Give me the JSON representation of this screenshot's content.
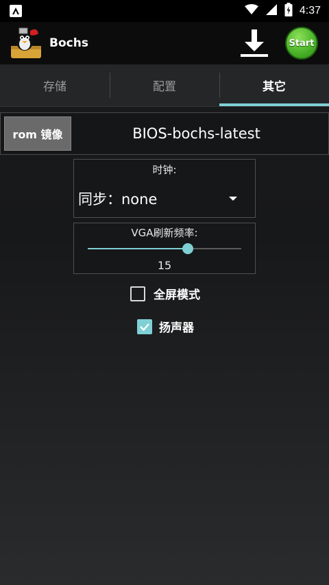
{
  "status_bar": {
    "time": "4:37"
  },
  "app_bar": {
    "title": "Bochs",
    "start_label": "Start"
  },
  "tabs": [
    {
      "label": "存储",
      "active": false
    },
    {
      "label": "配置",
      "active": false
    },
    {
      "label": "其它",
      "active": true
    }
  ],
  "rom": {
    "button_label": "rom 镜像",
    "value": "BIOS-bochs-latest"
  },
  "clock": {
    "label": "时钟:",
    "selected": "同步：none"
  },
  "vga": {
    "label": "VGA刷新频率:",
    "value": "15",
    "slider_fraction": 0.65
  },
  "checkboxes": {
    "fullscreen": {
      "label": "全屏模式",
      "checked": false
    },
    "speaker": {
      "label": "扬声器",
      "checked": true
    }
  },
  "colors": {
    "accent": "#7fd0d5",
    "start_green": "#4cb52a"
  }
}
